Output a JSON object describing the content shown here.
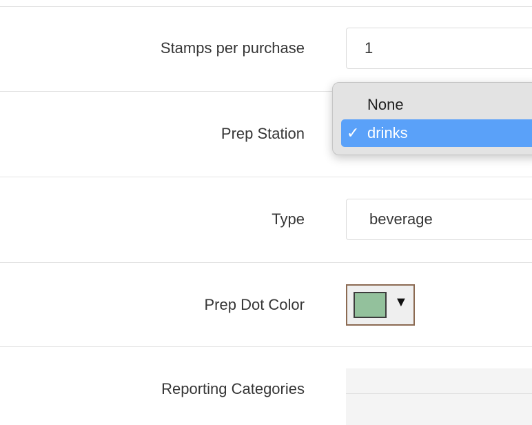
{
  "form": {
    "stamps_label": "Stamps per purchase",
    "stamps_value": "1",
    "prep_station_label": "Prep Station",
    "type_label": "Type",
    "type_value": "beverage",
    "prep_dot_color_label": "Prep Dot Color",
    "prep_dot_color_value": "#93c19c",
    "reporting_categories_label": "Reporting Categories"
  },
  "prep_station_dropdown": {
    "options": [
      "None",
      "drinks"
    ],
    "selected": "drinks",
    "check_glyph": "✓"
  },
  "colors": {
    "accent": "#5aa1f9",
    "swatch": "#93c19c",
    "swatch_border": "#8b6a52"
  },
  "icons": {
    "caret": "▼"
  }
}
